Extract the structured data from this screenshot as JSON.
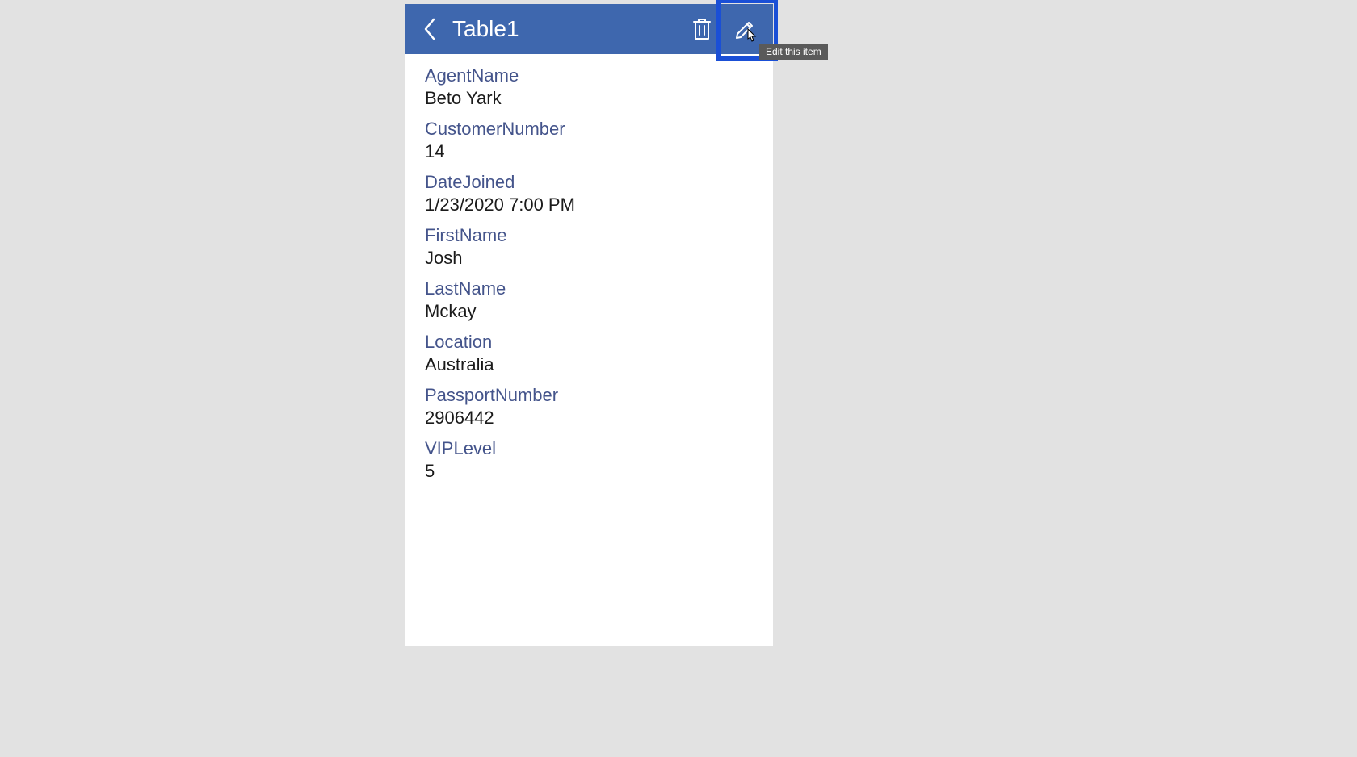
{
  "header": {
    "title": "Table1",
    "tooltip": "Edit this item"
  },
  "fields": [
    {
      "label": "AgentName",
      "value": "Beto Yark"
    },
    {
      "label": "CustomerNumber",
      "value": "14"
    },
    {
      "label": "DateJoined",
      "value": "1/23/2020 7:00 PM"
    },
    {
      "label": "FirstName",
      "value": "Josh"
    },
    {
      "label": "LastName",
      "value": "Mckay"
    },
    {
      "label": "Location",
      "value": "Australia"
    },
    {
      "label": "PassportNumber",
      "value": "2906442"
    },
    {
      "label": "VIPLevel",
      "value": "5"
    }
  ]
}
